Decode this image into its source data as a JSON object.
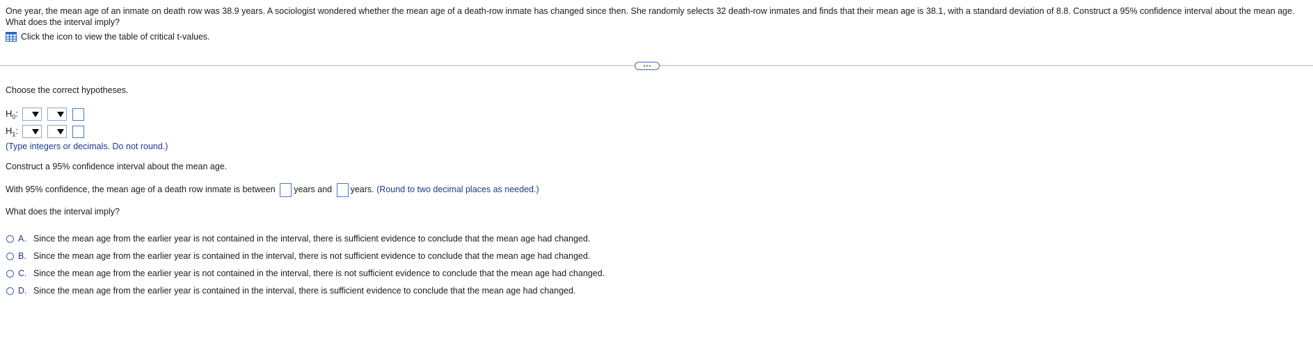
{
  "problem_text": "One year, the mean age of an inmate on death row was 38.9 years. A sociologist wondered whether the mean age of a death-row inmate has changed since then. She randomly selects 32 death-row inmates and finds that their mean age is 38.1, with a standard deviation of 8.8. Construct a 95% confidence interval about the mean age. What does the interval imply?",
  "table_link": {
    "icon": "table-grid-icon",
    "label": "Click the icon to view the table of critical t-values."
  },
  "expander": {
    "icon": "ellipsis-icon"
  },
  "hypotheses": {
    "prompt": "Choose the correct hypotheses.",
    "h0": {
      "label": "H",
      "sub": "0",
      "suffix": ":"
    },
    "h1": {
      "label": "H",
      "sub": "1",
      "suffix": ":"
    },
    "note": "(Type integers or decimals. Do not round.)"
  },
  "ci": {
    "prompt": "Construct a 95% confidence interval about the mean age.",
    "sentence_start": "With 95% confidence, the mean age of a death row inmate is between",
    "years_and": "years and",
    "years": "years.",
    "hint": "(Round to two decimal places as needed.)"
  },
  "implication": {
    "prompt": "What does the interval imply?",
    "options": [
      {
        "letter": "A.",
        "text": "Since the mean age from the earlier year is not contained in the interval, there is sufficient evidence to conclude that the mean age had changed."
      },
      {
        "letter": "B.",
        "text": "Since the mean age from the earlier year is contained in the interval, there is not sufficient evidence to conclude that the mean age had changed."
      },
      {
        "letter": "C.",
        "text": "Since the mean age from the earlier year is not contained in the interval, there is not sufficient evidence to conclude that the mean age had changed."
      },
      {
        "letter": "D.",
        "text": "Since the mean age from the earlier year is contained in the interval, there is sufficient evidence to conclude that the mean age had changed."
      }
    ]
  },
  "colors": {
    "accent": "#1d3a8a",
    "input_border": "#4a78c0"
  }
}
